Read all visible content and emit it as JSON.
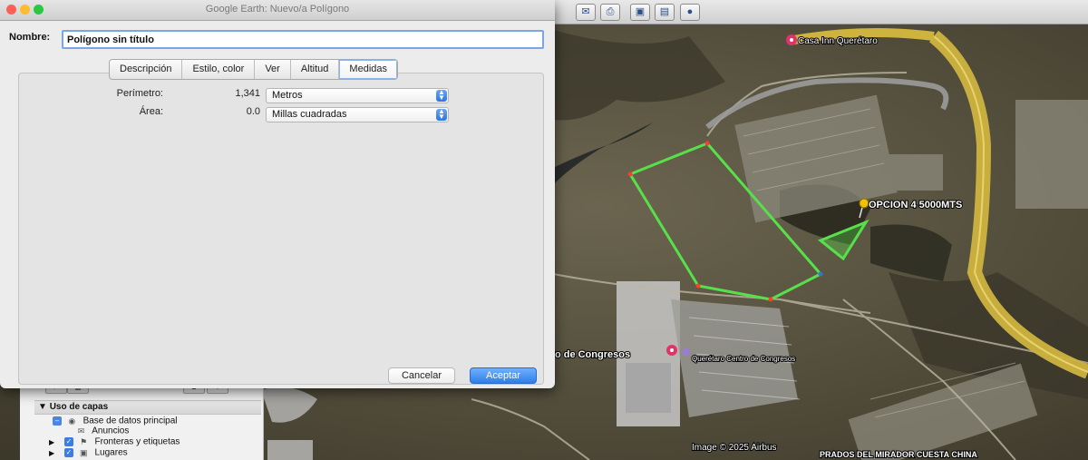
{
  "window": {
    "title": "Google Earth: Nuevo/a Polígono"
  },
  "form": {
    "name_label": "Nombre:",
    "name_value": "Polígono sin título"
  },
  "tabs": [
    {
      "label": "Descripción"
    },
    {
      "label": "Estilo, color"
    },
    {
      "label": "Ver"
    },
    {
      "label": "Altitud"
    },
    {
      "label": "Medidas",
      "active": true
    }
  ],
  "measures": {
    "perimeter_label": "Perímetro:",
    "perimeter_value": "1,341",
    "perimeter_unit": "Metros",
    "area_label": "Área:",
    "area_value": "0.0",
    "area_unit": "Millas cuadradas"
  },
  "buttons": {
    "cancel": "Cancelar",
    "accept": "Aceptar"
  },
  "sidebar": {
    "header": "Uso de capas",
    "layers": [
      {
        "label": "Base de datos principal"
      },
      {
        "label": "Anuncios"
      },
      {
        "label": "Fronteras y etiquetas"
      },
      {
        "label": "Lugares"
      }
    ]
  },
  "map": {
    "labels": {
      "hotel": "Casa Inn Querétaro",
      "opcion": "OPCION  4 5000MTS",
      "congresos_partial": "tro de Congresos",
      "congresos_full": "Querétaro Centro de Congresos",
      "copyright": "Image © 2025 Airbus",
      "neighborhood": "PRADOS DEL MIRADOR CUESTA CHINA"
    },
    "colors": {
      "polygon": "#58e04a",
      "road": "#d9c24a",
      "terrain": "#5c5440",
      "placemark": "#f2c200"
    }
  },
  "colors": {
    "accent": "#2f7ee8",
    "traffic_close": "#ff5f57",
    "traffic_min": "#febc2e",
    "traffic_max": "#28c840"
  }
}
